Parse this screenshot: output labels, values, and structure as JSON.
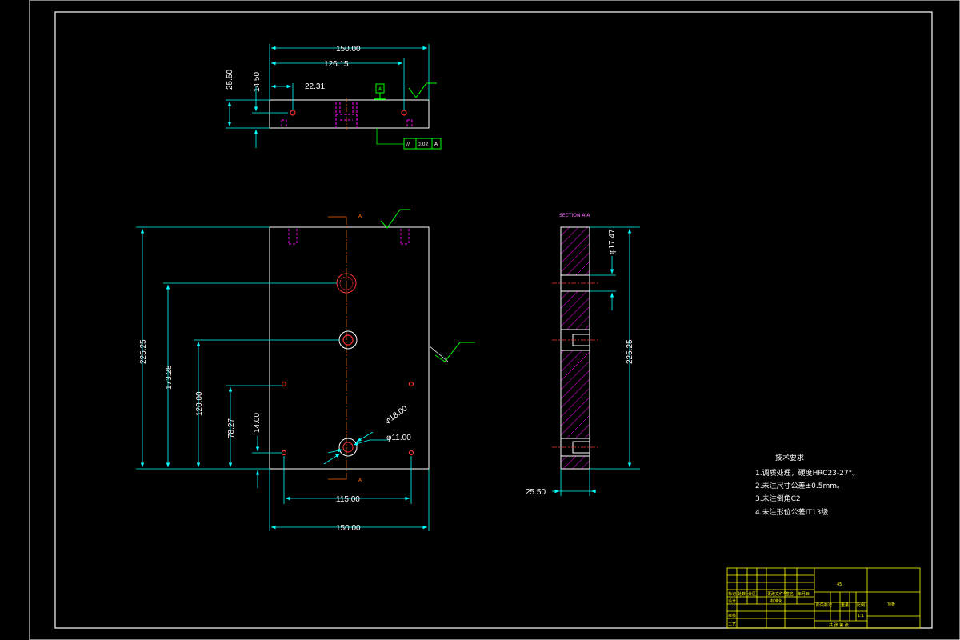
{
  "colors": {
    "background": "#000000",
    "frame": "#ffffff",
    "part": "#ffffff",
    "dimension": "#00ffff",
    "hidden": "#ff00ff",
    "centerline": "#ff6600",
    "hole": "#ff3333",
    "section": "#ff00ff",
    "datum": "#00ff00",
    "titleblock": "#ffff00"
  },
  "top_view": {
    "dims": {
      "width": "150.00",
      "holes_span": "126.15",
      "hole_offset": "22.31",
      "thickness": "25.50",
      "hole_depth": "14.50"
    },
    "datum_label": "A",
    "tolerance": {
      "symbol": "//",
      "value": "0.02",
      "datum": "A"
    }
  },
  "front_view": {
    "dims": {
      "height": "225.25",
      "dim_173": "173.28",
      "dim_120": "120.00",
      "dim_78": "78.27",
      "dim_14": "14.00",
      "holes_span": "115.00",
      "width": "150.00",
      "dia_big": "φ18.00",
      "dia_small": "φ11.00"
    },
    "section_mark": "A"
  },
  "section_view": {
    "title": "SECTION A-A",
    "dims": {
      "dia": "φ17.47",
      "height": "225.25",
      "thickness": "25.50"
    }
  },
  "requirements": {
    "title": "技术要求",
    "items": [
      "1.调质处理，硬度HRC23-27°。",
      "2.未注尺寸公差±0.5mm。",
      "3.未注倒角C2",
      "4.未注形位公差IT13级"
    ]
  },
  "title_block": {
    "scale_note": "45",
    "part_name": "顶板",
    "header_cells": [
      "标记",
      "处数",
      "分区",
      "更改文件号",
      "签名",
      "年月日"
    ],
    "rows": [
      "设计",
      "审核",
      "工艺"
    ],
    "approve": "标准化",
    "right_header": [
      "阶段标记",
      "重量",
      "比例"
    ],
    "ratio": "1:1",
    "sheet": "共 张 第 张"
  }
}
